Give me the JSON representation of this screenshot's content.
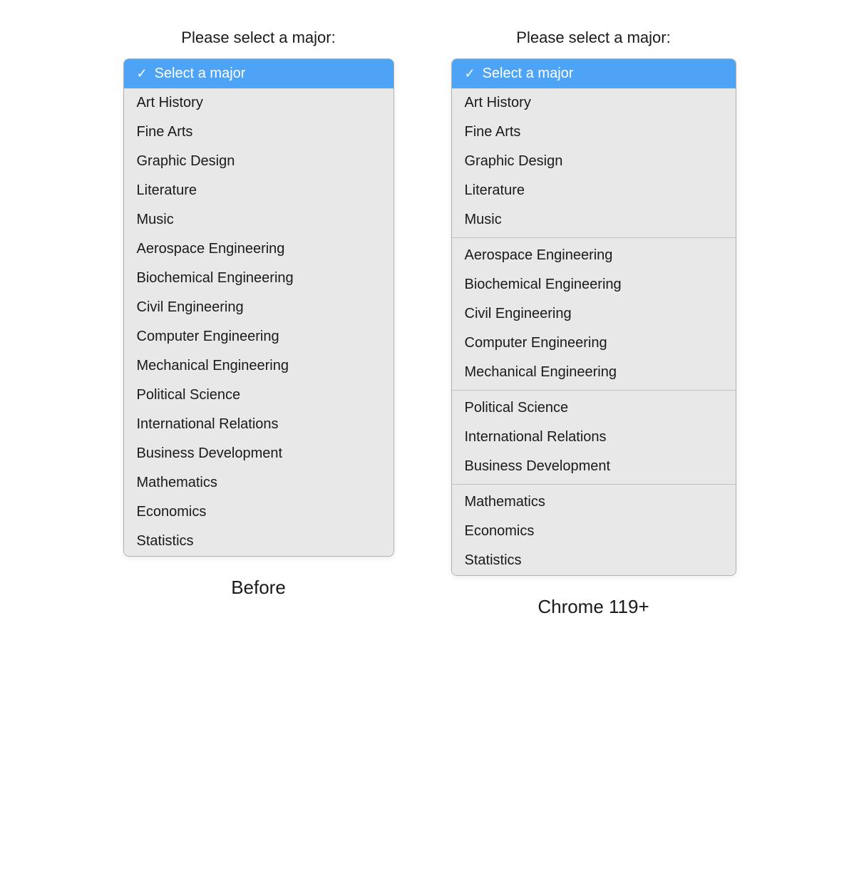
{
  "before": {
    "label": "Please select a major:",
    "caption": "Before",
    "selected_option": "Select a major",
    "options": [
      {
        "id": "select-major",
        "text": "Select a major",
        "selected": true,
        "check": true
      },
      {
        "id": "art-history",
        "text": "Art History",
        "selected": false
      },
      {
        "id": "fine-arts",
        "text": "Fine Arts",
        "selected": false
      },
      {
        "id": "graphic-design",
        "text": "Graphic Design",
        "selected": false
      },
      {
        "id": "literature",
        "text": "Literature",
        "selected": false
      },
      {
        "id": "music",
        "text": "Music",
        "selected": false
      },
      {
        "id": "aerospace-engineering",
        "text": "Aerospace Engineering",
        "selected": false
      },
      {
        "id": "biochemical-engineering",
        "text": "Biochemical Engineering",
        "selected": false
      },
      {
        "id": "civil-engineering",
        "text": "Civil Engineering",
        "selected": false
      },
      {
        "id": "computer-engineering",
        "text": "Computer Engineering",
        "selected": false
      },
      {
        "id": "mechanical-engineering",
        "text": "Mechanical Engineering",
        "selected": false
      },
      {
        "id": "political-science",
        "text": "Political Science",
        "selected": false
      },
      {
        "id": "international-relations",
        "text": "International Relations",
        "selected": false
      },
      {
        "id": "business-development",
        "text": "Business Development",
        "selected": false
      },
      {
        "id": "mathematics",
        "text": "Mathematics",
        "selected": false
      },
      {
        "id": "economics",
        "text": "Economics",
        "selected": false
      },
      {
        "id": "statistics",
        "text": "Statistics",
        "selected": false
      }
    ]
  },
  "chrome": {
    "label": "Please select a major:",
    "caption": "Chrome 119+",
    "selected_option": "Select a major",
    "groups": [
      {
        "id": "default",
        "options": [
          {
            "id": "select-major",
            "text": "Select a major",
            "selected": true,
            "check": true
          }
        ]
      },
      {
        "id": "arts",
        "options": [
          {
            "id": "art-history",
            "text": "Art History",
            "selected": false
          },
          {
            "id": "fine-arts",
            "text": "Fine Arts",
            "selected": false
          },
          {
            "id": "graphic-design",
            "text": "Graphic Design",
            "selected": false
          },
          {
            "id": "literature",
            "text": "Literature",
            "selected": false
          },
          {
            "id": "music",
            "text": "Music",
            "selected": false
          }
        ]
      },
      {
        "id": "engineering",
        "options": [
          {
            "id": "aerospace-engineering",
            "text": "Aerospace Engineering",
            "selected": false
          },
          {
            "id": "biochemical-engineering",
            "text": "Biochemical Engineering",
            "selected": false
          },
          {
            "id": "civil-engineering",
            "text": "Civil Engineering",
            "selected": false
          },
          {
            "id": "computer-engineering",
            "text": "Computer Engineering",
            "selected": false
          },
          {
            "id": "mechanical-engineering",
            "text": "Mechanical Engineering",
            "selected": false
          }
        ]
      },
      {
        "id": "social-sciences",
        "options": [
          {
            "id": "political-science",
            "text": "Political Science",
            "selected": false
          },
          {
            "id": "international-relations",
            "text": "International Relations",
            "selected": false
          },
          {
            "id": "business-development",
            "text": "Business Development",
            "selected": false
          }
        ]
      },
      {
        "id": "stem",
        "options": [
          {
            "id": "mathematics",
            "text": "Mathematics",
            "selected": false
          },
          {
            "id": "economics",
            "text": "Economics",
            "selected": false
          },
          {
            "id": "statistics",
            "text": "Statistics",
            "selected": false
          }
        ]
      }
    ]
  }
}
